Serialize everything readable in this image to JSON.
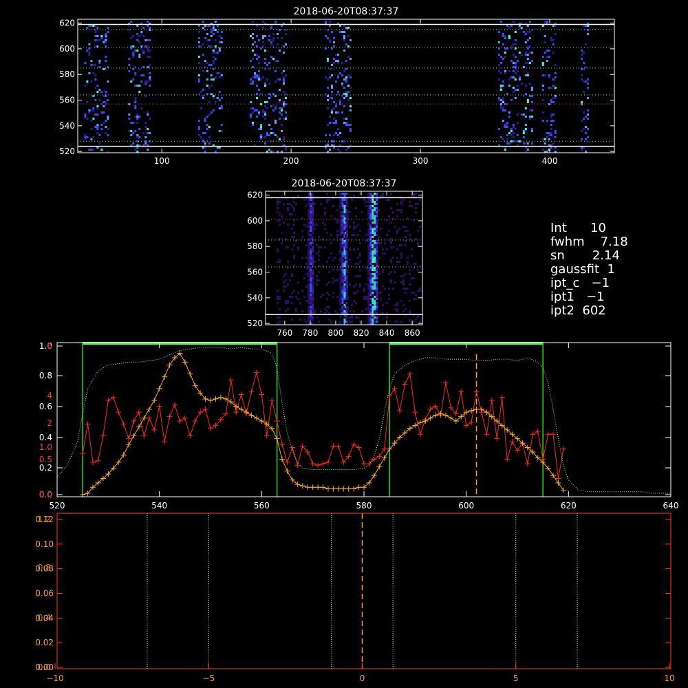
{
  "colors": {
    "axis": "#ffffff",
    "lower_axis": "#ff3b1f",
    "lower_tick_label": "#ffa030",
    "profile_red": "#ff2a1a",
    "profile_orange": "#ffae1f",
    "profile_green_dotted": "#b8ff88",
    "window_green": "#22dd22",
    "window_green_bar": "#33ff33",
    "marker_orange": "#ffa030",
    "heat_low": "#2a1aa0",
    "heat_mid": "#3b4cff",
    "heat_high": "#33ffcc"
  },
  "info_panel": {
    "lines": [
      "Int      10",
      "fwhm    7.18",
      "sn       2.14",
      "gaussfit  1",
      "ipt_c   −1",
      "ipt1   −1",
      "ipt2  602"
    ]
  },
  "chart_data": [
    {
      "type": "heatmap",
      "title": "2018-06-20T08:37:37",
      "xlabel": "",
      "ylabel": "",
      "xlim": [
        35,
        450
      ],
      "ylim": [
        519,
        623
      ],
      "xticks": [
        100,
        200,
        300,
        400
      ],
      "yticks": [
        520,
        540,
        560,
        580,
        600,
        620
      ],
      "column_bands": [
        [
          40,
          58
        ],
        [
          74,
          90
        ],
        [
          128,
          146
        ],
        [
          168,
          196
        ],
        [
          226,
          246
        ],
        [
          360,
          386
        ],
        [
          394,
          404
        ],
        [
          424,
          430
        ]
      ],
      "horizontal_lines": [
        {
          "y": 524,
          "style": "solid",
          "color": "#ffffff"
        },
        {
          "y": 619,
          "style": "solid",
          "color": "#ffffff"
        },
        {
          "y": 564,
          "style": "dotted",
          "color": "#66ff66"
        },
        {
          "y": 601,
          "style": "dotted",
          "color": "#66ff66"
        },
        {
          "y": 528,
          "style": "dotted",
          "color": "#66ff66"
        },
        {
          "y": 615,
          "style": "dotted",
          "color": "#66ff66"
        },
        {
          "y": 585,
          "style": "dotted",
          "color": "#66ff66"
        },
        {
          "y": 557,
          "style": "dotted",
          "color": "#ff4444"
        }
      ]
    },
    {
      "type": "heatmap",
      "title": "2018-06-20T08:37:37",
      "xlabel": "",
      "ylabel": "",
      "xlim": [
        745,
        868
      ],
      "ylim": [
        519,
        623
      ],
      "xticks": [
        760,
        780,
        800,
        820,
        840,
        860
      ],
      "yticks": [
        520,
        540,
        560,
        580,
        600,
        620
      ],
      "column_bands": [
        [
          778,
          782
        ],
        [
          803,
          809
        ],
        [
          825,
          833
        ]
      ],
      "horizontal_lines": [
        {
          "y": 564,
          "style": "dotted",
          "color": "#66ff66"
        },
        {
          "y": 585,
          "style": "dotted",
          "color": "#66ff66"
        },
        {
          "y": 601,
          "style": "dotted",
          "color": "#ff4444"
        },
        {
          "y": 618,
          "style": "solid",
          "color": "#ffffff"
        },
        {
          "y": 527,
          "style": "solid",
          "color": "#ffffff"
        }
      ]
    },
    {
      "type": "line",
      "title": "",
      "xlabel": "",
      "ylabel": "",
      "xlim": [
        520,
        640
      ],
      "xticks": [
        520,
        540,
        560,
        580,
        600,
        620,
        640
      ],
      "left_axis_white": {
        "labels": [
          "0.0",
          "0.2",
          "0.4",
          "0.6",
          "0.8",
          "1.0"
        ],
        "ylim": [
          0,
          1.0
        ]
      },
      "left_axis_red": {
        "labels": [
          "0.0",
          "0.5",
          "1.0",
          "2",
          "4",
          "6"
        ],
        "ylim": [
          0,
          6
        ]
      },
      "vertical_windows": [
        [
          525,
          563
        ],
        [
          585,
          615
        ]
      ],
      "marker_line_x": 602,
      "series": [
        {
          "color": "#ff2a1a",
          "style": "line+plus",
          "x": [
            525,
            526,
            527,
            528,
            529,
            530,
            531,
            532,
            533,
            534,
            535,
            536,
            537,
            538,
            539,
            540,
            541,
            542,
            543,
            544,
            545,
            546,
            547,
            548,
            549,
            550,
            551,
            552,
            553,
            554,
            555,
            556,
            557,
            558,
            559,
            560,
            561,
            562,
            563,
            564,
            565,
            566,
            567,
            568,
            569,
            570,
            571,
            572,
            573,
            574,
            575,
            576,
            577,
            578,
            579,
            580,
            581,
            582,
            583,
            584,
            585,
            586,
            587,
            588,
            589,
            590,
            591,
            592,
            593,
            594,
            595,
            596,
            597,
            598,
            599,
            600,
            601,
            602,
            603,
            604,
            605,
            606,
            607,
            608,
            609,
            610,
            611,
            612,
            613,
            614,
            615,
            616,
            617,
            618,
            619
          ],
          "y": [
            0.28,
            0.48,
            0.22,
            0.23,
            0.4,
            0.64,
            0.66,
            0.56,
            0.48,
            0.38,
            0.5,
            0.56,
            0.4,
            0.52,
            0.44,
            0.6,
            0.36,
            0.53,
            0.61,
            0.5,
            0.52,
            0.4,
            0.5,
            0.56,
            0.58,
            0.45,
            0.47,
            0.51,
            0.55,
            0.78,
            0.56,
            0.68,
            0.55,
            0.7,
            0.83,
            0.68,
            0.4,
            0.64,
            0.5,
            0.34,
            0.22,
            0.32,
            0.2,
            0.33,
            0.29,
            0.21,
            0.2,
            0.21,
            0.22,
            0.33,
            0.33,
            0.22,
            0.26,
            0.34,
            0.32,
            0.21,
            0.21,
            0.24,
            0.26,
            0.31,
            0.67,
            0.72,
            0.57,
            0.75,
            0.82,
            0.56,
            0.41,
            0.51,
            0.58,
            0.6,
            0.54,
            0.76,
            0.59,
            0.55,
            0.7,
            0.47,
            0.49,
            0.7,
            0.56,
            0.41,
            0.64,
            0.38,
            0.66,
            0.24,
            0.36,
            0.3,
            0.35,
            0.21,
            0.41,
            0.43,
            0.24,
            0.41,
            0.41,
            0.11,
            0.31
          ]
        },
        {
          "color": "#ffae1f",
          "style": "line+plus",
          "x": [
            525,
            526,
            527,
            528,
            529,
            530,
            531,
            532,
            533,
            534,
            535,
            536,
            537,
            538,
            539,
            540,
            541,
            542,
            543,
            544,
            545,
            546,
            547,
            548,
            549,
            550,
            551,
            552,
            553,
            554,
            555,
            556,
            557,
            558,
            559,
            560,
            561,
            562,
            563,
            564,
            565,
            566,
            567,
            568,
            569,
            570,
            571,
            572,
            573,
            574,
            575,
            576,
            577,
            578,
            579,
            580,
            581,
            582,
            583,
            584,
            585,
            586,
            587,
            588,
            589,
            590,
            591,
            592,
            593,
            594,
            595,
            596,
            597,
            598,
            599,
            600,
            601,
            602,
            603,
            604,
            605,
            606,
            607,
            608,
            609,
            610,
            611,
            612,
            613,
            614,
            615,
            616,
            617,
            618,
            619
          ],
          "y": [
            0.0,
            0.01,
            0.05,
            0.08,
            0.11,
            0.14,
            0.18,
            0.22,
            0.27,
            0.34,
            0.4,
            0.46,
            0.52,
            0.58,
            0.64,
            0.72,
            0.8,
            0.88,
            0.93,
            0.96,
            0.9,
            0.82,
            0.74,
            0.69,
            0.65,
            0.64,
            0.65,
            0.66,
            0.65,
            0.63,
            0.6,
            0.58,
            0.56,
            0.54,
            0.52,
            0.5,
            0.48,
            0.45,
            0.38,
            0.24,
            0.16,
            0.1,
            0.07,
            0.06,
            0.05,
            0.05,
            0.05,
            0.05,
            0.04,
            0.04,
            0.04,
            0.04,
            0.04,
            0.04,
            0.05,
            0.05,
            0.08,
            0.13,
            0.19,
            0.25,
            0.31,
            0.35,
            0.39,
            0.42,
            0.45,
            0.47,
            0.49,
            0.5,
            0.52,
            0.54,
            0.55,
            0.54,
            0.52,
            0.5,
            0.53,
            0.56,
            0.57,
            0.58,
            0.58,
            0.56,
            0.53,
            0.5,
            0.47,
            0.44,
            0.41,
            0.38,
            0.35,
            0.32,
            0.29,
            0.25,
            0.22,
            0.18,
            0.13,
            0.08,
            0.03
          ]
        },
        {
          "color": "#b8ff88",
          "style": "dotted",
          "x": [
            520,
            522,
            524,
            525,
            526,
            528,
            530,
            532,
            534,
            536,
            538,
            540,
            542,
            544,
            546,
            548,
            550,
            552,
            554,
            556,
            558,
            560,
            562,
            563,
            564,
            565,
            566,
            567,
            568,
            570,
            572,
            574,
            576,
            578,
            580,
            581,
            582,
            583,
            584,
            585,
            586,
            588,
            590,
            592,
            594,
            596,
            598,
            600,
            602,
            604,
            606,
            608,
            610,
            612,
            614,
            615,
            616,
            617,
            618,
            619,
            620,
            622,
            624,
            626,
            628,
            630,
            632,
            634,
            636,
            638,
            640
          ],
          "y": [
            0.12,
            0.2,
            0.36,
            0.55,
            0.72,
            0.84,
            0.88,
            0.89,
            0.9,
            0.9,
            0.91,
            0.92,
            0.95,
            0.98,
            0.99,
            1.0,
            1.0,
            1.0,
            0.99,
            1.0,
            0.99,
            0.99,
            0.96,
            0.86,
            0.62,
            0.42,
            0.3,
            0.22,
            0.18,
            0.17,
            0.17,
            0.17,
            0.17,
            0.17,
            0.18,
            0.2,
            0.26,
            0.38,
            0.56,
            0.72,
            0.82,
            0.88,
            0.91,
            0.93,
            0.93,
            0.92,
            0.92,
            0.92,
            0.91,
            0.91,
            0.92,
            0.92,
            0.91,
            0.93,
            0.9,
            0.86,
            0.76,
            0.58,
            0.38,
            0.2,
            0.1,
            0.03,
            0.02,
            0.02,
            0.02,
            0.02,
            0.02,
            0.02,
            0.01,
            0.01,
            0.01
          ]
        }
      ]
    },
    {
      "type": "line",
      "title": "",
      "xlabel": "",
      "ylabel": "",
      "xlim": [
        -10,
        10
      ],
      "ylim": [
        0,
        0.12
      ],
      "xticks": [
        -10,
        -5,
        0,
        5,
        10
      ],
      "xtick_labels": [
        "−10",
        "−5",
        "0",
        "5",
        "10"
      ],
      "yticks": [
        0.0,
        0.02,
        0.04,
        0.06,
        0.08,
        0.1,
        0.12
      ],
      "ytick_labels": [
        "0.00",
        "0.02",
        "0.04",
        "0.06",
        "0.08",
        "0.10",
        "0.12"
      ],
      "overlay_ytick_labels": [
        "0.0",
        "0.4",
        "0.8",
        "1.2"
      ],
      "dotted_vlines": [
        -7,
        -5,
        -1,
        1,
        5,
        7
      ],
      "dashed_vline": 0,
      "series": []
    }
  ]
}
